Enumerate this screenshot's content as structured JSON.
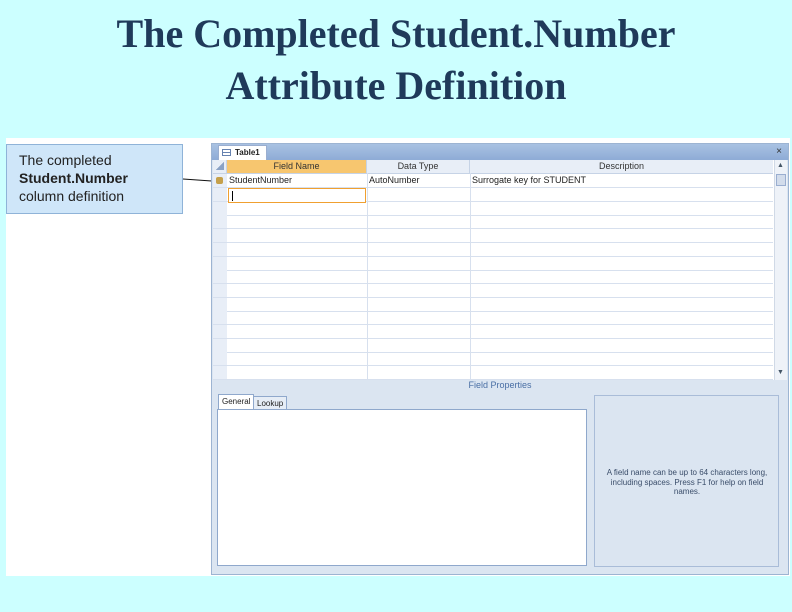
{
  "slide": {
    "title_line1": "The Completed Student.Number",
    "title_line2": "Attribute Definition"
  },
  "callout": {
    "line1": "The completed",
    "line2": "Student.Number",
    "line3": "column definition"
  },
  "window": {
    "tab_label": "Table1",
    "close_glyph": "×"
  },
  "grid": {
    "headers": [
      "Field Name",
      "Data Type",
      "Description"
    ],
    "rows": [
      {
        "field_name": "StudentNumber",
        "data_type": "AutoNumber",
        "description": "Surrogate key for STUDENT"
      }
    ],
    "empty_row_count": 14
  },
  "field_properties": {
    "label": "Field Properties",
    "tabs": [
      "General",
      "Lookup"
    ],
    "help_text": "A field name can be up to 64 characters long, including spaces. Press F1 for help on field names."
  },
  "colors": {
    "slide_bg": "#ccffff",
    "title": "#1f3a5a",
    "selected_header": "#f7c66f",
    "active_cell_border": "#f0a030"
  }
}
